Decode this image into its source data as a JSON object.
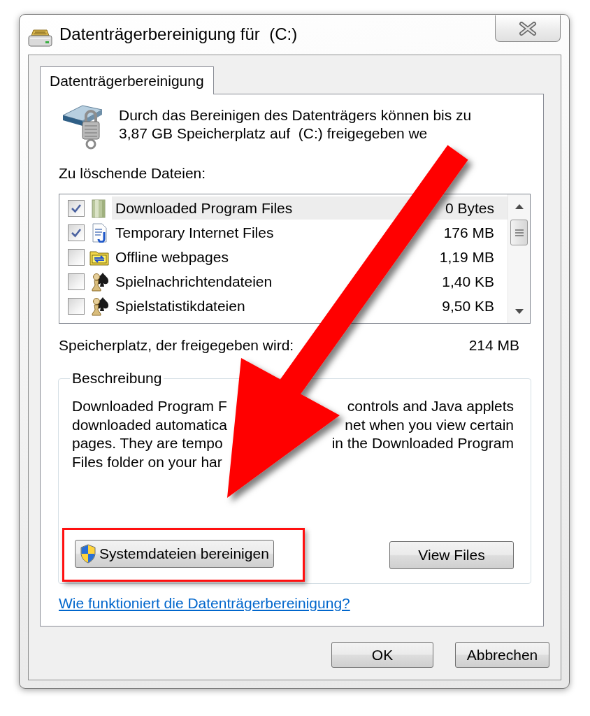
{
  "window": {
    "title": "Datenträgerbereinigung für  (C:)"
  },
  "tabs": [
    {
      "label": "Datenträgerbereinigung",
      "selected": true
    }
  ],
  "summary": "Durch das Bereinigen des Datenträgers können bis zu\n3,87 GB Speicherplatz auf  (C:) freigegeben we",
  "files_label": "Zu löschende Dateien:",
  "files": [
    {
      "kind": "folder",
      "name": "Downloaded Program Files",
      "size": "0 Bytes",
      "checked": true,
      "selected": true
    },
    {
      "kind": "document",
      "name": "Temporary Internet Files",
      "size": "176 MB",
      "checked": true,
      "selected": false
    },
    {
      "kind": "webfolder",
      "name": "Offline webpages",
      "size": "1,19 MB",
      "checked": false,
      "selected": false
    },
    {
      "kind": "game",
      "name": "Spielnachrichtendateien",
      "size": "1,40 KB",
      "checked": false,
      "selected": false
    },
    {
      "kind": "game",
      "name": "Spielstatistikdateien",
      "size": "9,50 KB",
      "checked": false,
      "selected": false
    }
  ],
  "space": {
    "label": "Speicherplatz, der freigegeben wird:",
    "value": "214 MB"
  },
  "description": {
    "legend": "Beschreibung",
    "lines": [
      {
        "start": "Downloaded Program F",
        "end": "controls and Java applets"
      },
      {
        "start": "downloaded automatica",
        "end": "net when you view certain"
      },
      {
        "start": "pages. They are tempo",
        "end": "in the Downloaded Program"
      },
      {
        "start": "Files folder on your har"
      }
    ]
  },
  "buttons": [
    {
      "kind": "shield",
      "label": "Systemdateien bereinigen",
      "highlighted": true
    },
    {
      "kind": "plain",
      "label": "View Files",
      "highlighted": false
    }
  ],
  "help_link": "Wie funktioniert die Datenträgerbereinigung?",
  "dialog_buttons": [
    "OK",
    "Abbrechen"
  ],
  "annotations": [
    {
      "kind": "arrow"
    }
  ]
}
